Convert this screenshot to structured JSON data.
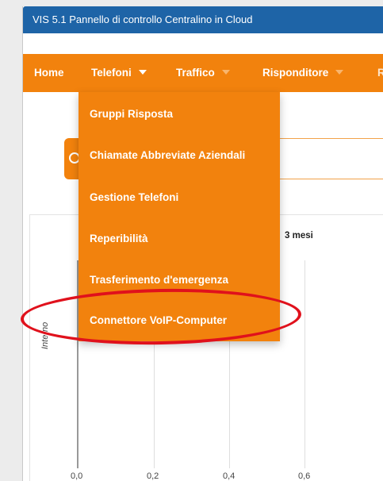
{
  "window": {
    "title": "VIS 5.1 Pannello di controllo Centralino in Cloud"
  },
  "navbar": {
    "items": [
      {
        "label": "Home",
        "has_caret": false
      },
      {
        "label": "Telefoni",
        "has_caret": true
      },
      {
        "label": "Traffico",
        "has_caret": true
      },
      {
        "label": "Risponditore",
        "has_caret": true
      },
      {
        "label": "R",
        "has_caret": false
      }
    ]
  },
  "dropdown": {
    "items": [
      {
        "label": "Gruppi Risposta"
      },
      {
        "label": "Chiamate Abbreviate Aziendali"
      },
      {
        "label": "Gestione Telefoni"
      },
      {
        "label": "Reperibilità"
      },
      {
        "label": "Trasferimento d'emergenza"
      },
      {
        "label": "Connettore VoIP-Computer",
        "highlighted": true
      }
    ]
  },
  "chart_panel": {
    "title_fragment": "3 mesi",
    "y_axis_label": "Interno",
    "x_ticks": [
      "0,0",
      "0,2",
      "0,4",
      "0,6"
    ]
  },
  "colors": {
    "titlebar": "#1e64a7",
    "navbar": "#f2820d",
    "highlight": "#e0111c"
  }
}
